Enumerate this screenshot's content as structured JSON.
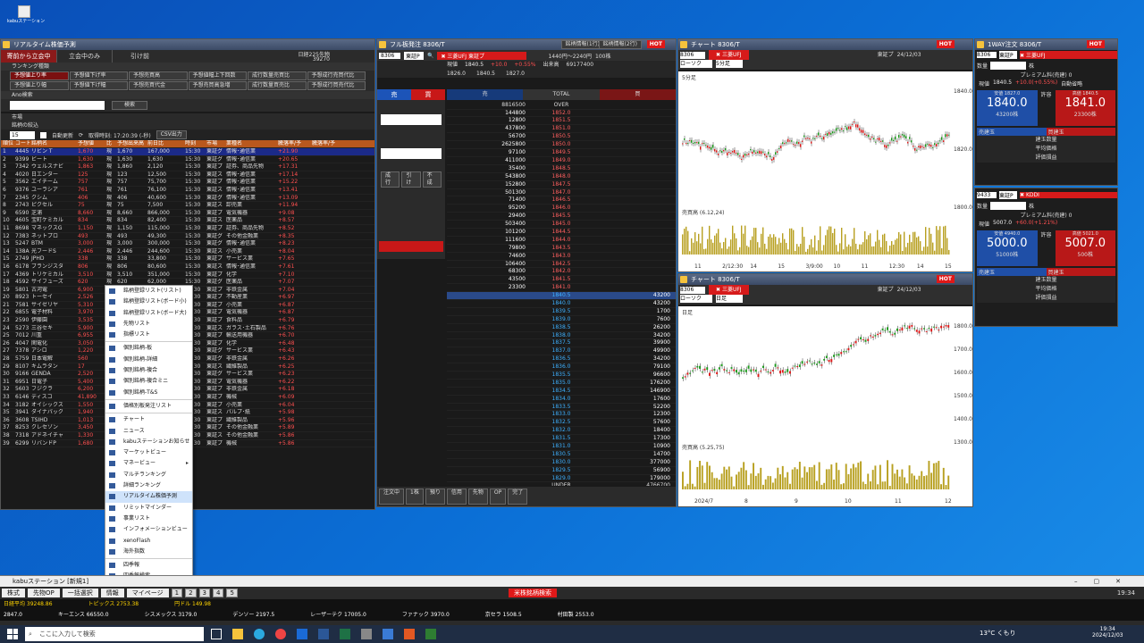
{
  "desktop": {
    "icon_label": "kabuステーション"
  },
  "ranking": {
    "title": "リアルタイム株価予測",
    "tabs": [
      "寄前から立会中",
      "立会中のみ",
      "引け前"
    ],
    "index_label": "日経225先物",
    "index_value": "39270",
    "menu_label": "ランキング種類",
    "types_row1": [
      "予想値上り率",
      "予想値下げ率",
      "予想売買高",
      "予想値幅上下回数",
      "成行数量売買比",
      "予想成行売買代比"
    ],
    "types_row2": [
      "予想値上り幅",
      "予想値下げ幅",
      "予想売買代金",
      "予想売買高急増",
      "成行数量買売比",
      "予想成行買売代比"
    ],
    "ana_label": "Ano検索",
    "search_btn": "検索",
    "market_label": "市場",
    "filter_label": "銘柄の絞込",
    "count": "15",
    "auto_label": "自動更新",
    "time_label": "取得時刻: 17:20:39 (-秒)",
    "csv": "CSV出力",
    "columns": [
      "順位",
      "コード",
      "銘柄名",
      "予想値",
      "比",
      "予想出来高",
      "前日比",
      "時刻",
      "市場",
      "業種名",
      "騰落率/予",
      "騰落率/予"
    ],
    "rows": [
      [
        "1",
        "4445",
        "リビン T",
        "1,670",
        "現",
        "1,670",
        "167,000",
        "15:30",
        "東証グ",
        "情報･通信業",
        "+21.90"
      ],
      [
        "2",
        "9399",
        "ビート",
        "1,630",
        "現",
        "1,630",
        "1,630",
        "15:30",
        "東証グ",
        "情報･通信業",
        "+20.65"
      ],
      [
        "3",
        "7342",
        "ウェルスナビ",
        "1,863",
        "現",
        "1,860",
        "2,120",
        "15:30",
        "東証プ",
        "証券、商品先物",
        "+17.31"
      ],
      [
        "4",
        "4020",
        "日エンター",
        "125",
        "現",
        "123",
        "12,500",
        "15:30",
        "東証ス",
        "情報･通信業",
        "+17.14"
      ],
      [
        "5",
        "3562",
        "エイチーム",
        "757",
        "現",
        "757",
        "75,700",
        "15:30",
        "東証プ",
        "情報･通信業",
        "+15.22"
      ],
      [
        "6",
        "9376",
        "ユーラシア",
        "761",
        "現",
        "761",
        "76,100",
        "15:30",
        "東証ス",
        "情報･通信業",
        "+13.41"
      ],
      [
        "7",
        "2345",
        "クシム",
        "406",
        "現",
        "406",
        "40,600",
        "15:30",
        "東証グ",
        "情報･通信業",
        "+13.09"
      ],
      [
        "8",
        "2743",
        "ピクセル",
        "75",
        "現",
        "75",
        "7,500",
        "15:30",
        "東証ス",
        "卸売業",
        "+11.94"
      ],
      [
        "9",
        "6590",
        "芝浦",
        "8,660",
        "現",
        "8,660",
        "866,000",
        "15:30",
        "東証プ",
        "電気機器",
        "+9.08"
      ],
      [
        "10",
        "4605",
        "宝町ケミカル",
        "834",
        "現",
        "834",
        "82,400",
        "15:30",
        "東証ス",
        "医薬品",
        "+8.57"
      ],
      [
        "11",
        "8698",
        "マネックスG",
        "1,150",
        "現",
        "1,150",
        "115,000",
        "15:30",
        "東証プ",
        "証券、商品先物",
        "+8.52"
      ],
      [
        "12",
        "7383",
        "ネットプロ",
        "493",
        "現",
        "493",
        "49,300",
        "15:30",
        "東証グ",
        "その他金融業",
        "+8.35"
      ],
      [
        "13",
        "5247",
        "BTM",
        "3,000",
        "現",
        "3,000",
        "300,000",
        "15:30",
        "東証グ",
        "情報･通信業",
        "+8.23"
      ],
      [
        "14",
        "138A",
        "光フードS",
        "2,446",
        "現",
        "2,446",
        "244,600",
        "15:30",
        "東証ス",
        "小売業",
        "+8.04"
      ],
      [
        "15",
        "2749",
        "JPHD",
        "338",
        "現",
        "338",
        "33,800",
        "15:30",
        "東証プ",
        "サービス業",
        "+7.65"
      ],
      [
        "16",
        "6178",
        "ブランジスタ",
        "806",
        "現",
        "806",
        "80,600",
        "15:30",
        "東証ス",
        "情報･通信業",
        "+7.61"
      ],
      [
        "17",
        "4369",
        "トリケミカル",
        "3,510",
        "現",
        "3,510",
        "351,000",
        "15:30",
        "東証プ",
        "化学",
        "+7.10"
      ],
      [
        "18",
        "4592",
        "サイフューズ",
        "620",
        "現",
        "620",
        "62,000",
        "15:30",
        "東証グ",
        "医薬品",
        "+7.07"
      ],
      [
        "19",
        "5801",
        "古河電",
        "6,900",
        "現",
        "6,900",
        "690,000",
        "15:30",
        "東証プ",
        "非鉄金属",
        "+7.04"
      ],
      [
        "20",
        "8923",
        "トーセイ",
        "2,526",
        "現",
        "2,526",
        "252,600",
        "15:30",
        "東証プ",
        "不動産業",
        "+6.97"
      ],
      [
        "21",
        "7581",
        "サイゼリヤ",
        "5,310",
        "現",
        "5,310",
        "531,000",
        "15:30",
        "東証プ",
        "小売業",
        "+6.87"
      ],
      [
        "22",
        "6855",
        "電子材料",
        "3,970",
        "現",
        "3,970",
        "397,000",
        "15:30",
        "東証プ",
        "電気機器",
        "+6.87"
      ],
      [
        "23",
        "2590",
        "伊藤園",
        "3,535",
        "現",
        "3,535",
        "353,500",
        "15:30",
        "東証プ",
        "食料品",
        "+6.79"
      ],
      [
        "24",
        "5273",
        "三谷セキ",
        "5,900",
        "現",
        "5,900",
        "590,000",
        "15:30",
        "東証ス",
        "ガラス･土石製品",
        "+6.76"
      ],
      [
        "25",
        "7012",
        "川重",
        "6,955",
        "現",
        "6,955",
        "695,500",
        "15:30",
        "東証プ",
        "輸送用機器",
        "+6.70"
      ],
      [
        "26",
        "4047",
        "関電化",
        "3,050",
        "現",
        "3,050",
        "305,000",
        "15:30",
        "東証プ",
        "化学",
        "+6.48"
      ],
      [
        "27",
        "7378",
        "アシロ",
        "1,220",
        "現",
        "1,220",
        "122,000",
        "15:30",
        "東証グ",
        "サービス業",
        "+6.43"
      ],
      [
        "28",
        "5759",
        "日本電解",
        "560",
        "現",
        "560",
        "56,000",
        "15:30",
        "東証グ",
        "非鉄金属",
        "+6.26"
      ],
      [
        "29",
        "8107",
        "キムラタン",
        "17",
        "現",
        "17",
        "1,700",
        "15:30",
        "東証ス",
        "繊維製品",
        "+6.25"
      ],
      [
        "30",
        "9166",
        "GENDA",
        "2,520",
        "現",
        "2,520",
        "252,000",
        "15:30",
        "東証グ",
        "サービス業",
        "+6.23"
      ],
      [
        "31",
        "6951",
        "日電子",
        "5,400",
        "現",
        "5,400",
        "540,000",
        "15:30",
        "東証プ",
        "電気機器",
        "+6.22"
      ],
      [
        "32",
        "5603",
        "フジクラ",
        "6,200",
        "現",
        "6,200",
        "620,000",
        "15:30",
        "東証プ",
        "非鉄金属",
        "+6.18"
      ],
      [
        "33",
        "6146",
        "ディスコ",
        "41,890",
        "現",
        "41,890",
        "4,189,000",
        "15:30",
        "東証プ",
        "機械",
        "+6.09"
      ],
      [
        "34",
        "3182",
        "オイシックス",
        "1,550",
        "現",
        "1,550",
        "155,000",
        "15:30",
        "東証プ",
        "小売業",
        "+6.04"
      ],
      [
        "35",
        "3941",
        "ダイナパック",
        "1,940",
        "現",
        "1,940",
        "194,000",
        "15:30",
        "東証ス",
        "パルプ･紙",
        "+5.98"
      ],
      [
        "36",
        "3608",
        "TSIHD",
        "1,013",
        "現",
        "1,013",
        "101,300",
        "15:30",
        "東証プ",
        "繊維製品",
        "+5.96"
      ],
      [
        "37",
        "8253",
        "クレセゾン",
        "3,450",
        "現",
        "3,450",
        "345,000",
        "15:30",
        "東証プ",
        "その他金融業",
        "+5.89"
      ],
      [
        "38",
        "7318",
        "アドネイチャ",
        "1,330",
        "現",
        "1,330",
        "133,000",
        "15:30",
        "東証ス",
        "その他金融業",
        "+5.86"
      ],
      [
        "39",
        "6299",
        "リバンドP",
        "1,680",
        "現",
        "1,680",
        "168,000",
        "15:30",
        "東証プ",
        "機械",
        "+5.86"
      ]
    ]
  },
  "context_menu": {
    "items": [
      {
        "label": "銘柄登録リスト(リスト)",
        "sep": false
      },
      {
        "label": "銘柄登録リスト(ボード小)",
        "sep": false
      },
      {
        "label": "銘柄登録リスト(ボード大)",
        "sep": false
      },
      {
        "label": "先物リスト",
        "sep": false
      },
      {
        "label": "指標リスト",
        "sep": true
      },
      {
        "label": "個別銘柄-板",
        "sep": false
      },
      {
        "label": "個別銘柄-詳細",
        "sep": false
      },
      {
        "label": "個別銘柄-複合",
        "sep": false
      },
      {
        "label": "個別銘柄-複合ミニ",
        "sep": false
      },
      {
        "label": "個別銘柄-T&S",
        "sep": true
      },
      {
        "label": "価格別板発注リスト",
        "sep": true
      },
      {
        "label": "チャート",
        "sep": false
      },
      {
        "label": "ニュース",
        "sep": false
      },
      {
        "label": "kabuステーションお知らせ",
        "sep": false
      },
      {
        "label": "マーケットビュー",
        "sep": false
      },
      {
        "label": "マネービュー",
        "sep": false,
        "arrow": true
      },
      {
        "label": "マルチランキング",
        "sep": false
      },
      {
        "label": "詳細ランキング",
        "sep": false
      },
      {
        "label": "リアルタイム株価予測",
        "sep": false,
        "selected": true
      },
      {
        "label": "リミットマインダー",
        "sep": false
      },
      {
        "label": "事業リスト",
        "sep": false
      },
      {
        "label": "インフォメーションビュー",
        "sep": false
      },
      {
        "label": "xenoFlash",
        "sep": false
      },
      {
        "label": "海外指数",
        "sep": true
      },
      {
        "label": "四季報",
        "sep": false
      },
      {
        "label": "四季報検索",
        "sep": true
      },
      {
        "label": "オプションビュー",
        "sep": false,
        "arrow": true
      },
      {
        "label": "ミニオプションビュー(限月)",
        "sep": false,
        "arrow": true
      },
      {
        "label": "ミニオプションビュー(限週)",
        "sep": false,
        "arrow": true
      },
      {
        "label": "関連情報",
        "sep": false,
        "arrow": true
      }
    ]
  },
  "board": {
    "title": "フル板発注 8306/T",
    "code": "8306",
    "market": "東証P",
    "name": "三菱UFJ",
    "exchange": "東証プ",
    "btn1": "銘柄情報(1行)",
    "btn2": "銘柄情報(2行)",
    "hot": "HOT",
    "range": "1440円〜2240円",
    "unit": "100株",
    "price_label": "現値",
    "price": "1840.5",
    "change": "+10.0",
    "change_pct": "+0.55%",
    "volume_label": "出来高",
    "volume": "69177400",
    "open": "1826.0",
    "high": "1840.5",
    "low": "1827.0",
    "sell": "売",
    "buy": "買",
    "market_order": "成行",
    "after": "引け",
    "unexec": "不成",
    "over": "OVER",
    "under": "UNDER",
    "total": "TOTAL",
    "over_qty": "8816500",
    "under_qty": "4766700",
    "ask": [
      [
        "144800",
        "1852.0"
      ],
      [
        "12800",
        "1851.5"
      ],
      [
        "437800",
        "1851.0"
      ],
      [
        "56700",
        "1850.5"
      ],
      [
        "2625800",
        "1850.0"
      ],
      [
        "97100",
        "1849.5"
      ],
      [
        "411000",
        "1849.0"
      ],
      [
        "35400",
        "1848.5"
      ],
      [
        "543800",
        "1848.0"
      ],
      [
        "152800",
        "1847.5"
      ],
      [
        "501300",
        "1847.0"
      ],
      [
        "71400",
        "1846.5"
      ],
      [
        "95200",
        "1846.0"
      ],
      [
        "29400",
        "1845.5"
      ],
      [
        "503400",
        "1845.0"
      ],
      [
        "101200",
        "1844.5"
      ],
      [
        "111600",
        "1844.0"
      ],
      [
        "79800",
        "1843.5"
      ],
      [
        "74600",
        "1843.0"
      ],
      [
        "106400",
        "1842.5"
      ],
      [
        "68300",
        "1842.0"
      ],
      [
        "43500",
        "1841.5"
      ],
      [
        "23300",
        "1841.0"
      ]
    ],
    "bid": [
      [
        "1840.5",
        "43200"
      ],
      [
        "1840.0",
        "43200"
      ],
      [
        "1839.5",
        "1700"
      ],
      [
        "1839.0",
        "7600"
      ],
      [
        "1838.5",
        "26200"
      ],
      [
        "1838.0",
        "34200"
      ],
      [
        "1837.5",
        "39900"
      ],
      [
        "1837.0",
        "49900"
      ],
      [
        "1836.5",
        "34200"
      ],
      [
        "1836.0",
        "79100"
      ],
      [
        "1835.5",
        "96600"
      ],
      [
        "1835.0",
        "176200"
      ],
      [
        "1834.5",
        "146900"
      ],
      [
        "1834.0",
        "17600"
      ],
      [
        "1833.5",
        "52200"
      ],
      [
        "1833.0",
        "12300"
      ],
      [
        "1832.5",
        "57600"
      ],
      [
        "1832.0",
        "18400"
      ],
      [
        "1831.5",
        "17300"
      ],
      [
        "1831.0",
        "10900"
      ],
      [
        "1830.5",
        "14700"
      ],
      [
        "1830.0",
        "377000"
      ],
      [
        "1829.5",
        "56900"
      ],
      [
        "1829.0",
        "179000"
      ]
    ],
    "bottom_tabs": [
      "注文中",
      "1株",
      "預り",
      "信用",
      "先物",
      "OP",
      "完了"
    ]
  },
  "chart1": {
    "title": "チャート 8306/T",
    "name": "三菱UFJ",
    "market": "東証プ",
    "date": "24/12/03",
    "type": "ローソク",
    "interval": "5分足",
    "label": "5分足",
    "vol_label": "売買高 (6.12,24)",
    "yticks": [
      "1840.0",
      "1820.0",
      "1800.0"
    ],
    "xticks": [
      "11",
      "2/12:30",
      "14",
      "15",
      "3/9:00",
      "10",
      "11",
      "12:30",
      "14",
      "15"
    ]
  },
  "chart2": {
    "title": "チャート 8306/T",
    "name": "三菱UFJ",
    "market": "東証プ",
    "date": "24/12/03",
    "type": "ローソク",
    "interval": "日足",
    "label": "日足",
    "vol_label": "売買高 (5.25,75)",
    "yticks": [
      "1800.0",
      "1700.0",
      "1600.0",
      "1500.0",
      "1400.0",
      "1300.0"
    ],
    "xticks": [
      "2024/7",
      "8",
      "9",
      "10",
      "11",
      "12"
    ]
  },
  "order1": {
    "title": "1WAY注文 8306/T",
    "code": "8306",
    "market": "東証P",
    "name": "三菱UFJ",
    "qty_label": "数量",
    "unit": "株",
    "premium_label": "プレミアム料(売建)",
    "premium": "0",
    "cur_label": "現値",
    "cur": "1840.5",
    "change": "+10.0(+0.55%)",
    "auto": "自動省略",
    "sell_head": "安値 1827.0",
    "sell_price": "1840.0",
    "sell_qty": "43200株",
    "buy_head": "高値 1840.5",
    "buy_price": "1841.0",
    "buy_qty": "23300株",
    "jun": "許容",
    "sell_pos": "売建玉",
    "buy_pos": "買建玉",
    "r1": "建玉数量",
    "r2": "平均価格",
    "r3": "評価損益"
  },
  "order2": {
    "code": "9433",
    "market": "東証P",
    "name": "KDDI",
    "premium": "0",
    "cur": "5007.0",
    "change": "+60.0(+1.21%)",
    "sell_head": "安値 4940.0",
    "sell_price": "5000.0",
    "sell_qty": "51000株",
    "buy_head": "高値 5021.0",
    "buy_price": "5007.0",
    "buy_qty": "500株"
  },
  "toolbar": {
    "title": "kabuステーション [新規1]",
    "buttons": [
      "株式",
      "先物OP",
      "一括選択",
      "情報",
      "マイページ"
    ],
    "pages": [
      "1",
      "2",
      "3",
      "4",
      "5"
    ],
    "alert": "米株銘柄検索",
    "time": "19:34"
  },
  "ticker": {
    "items": [
      "日経平均 39248.86",
      "トピックス 2753.38",
      "円ドル 149.98"
    ]
  },
  "ticker_rows": [
    [
      "2847.0",
      "キーエンス 66550.0",
      "シスメックス 3179.0",
      "デンソー 2197.5",
      "レーザーテク 17005.0",
      "ファナック 3970.0",
      "京セラ 1508.5",
      "村田製 2553.0"
    ]
  ],
  "taskbar": {
    "search": "ここに入力して検索",
    "weather": "13°C くもり",
    "time": "19:34",
    "date": "2024/12/03"
  }
}
